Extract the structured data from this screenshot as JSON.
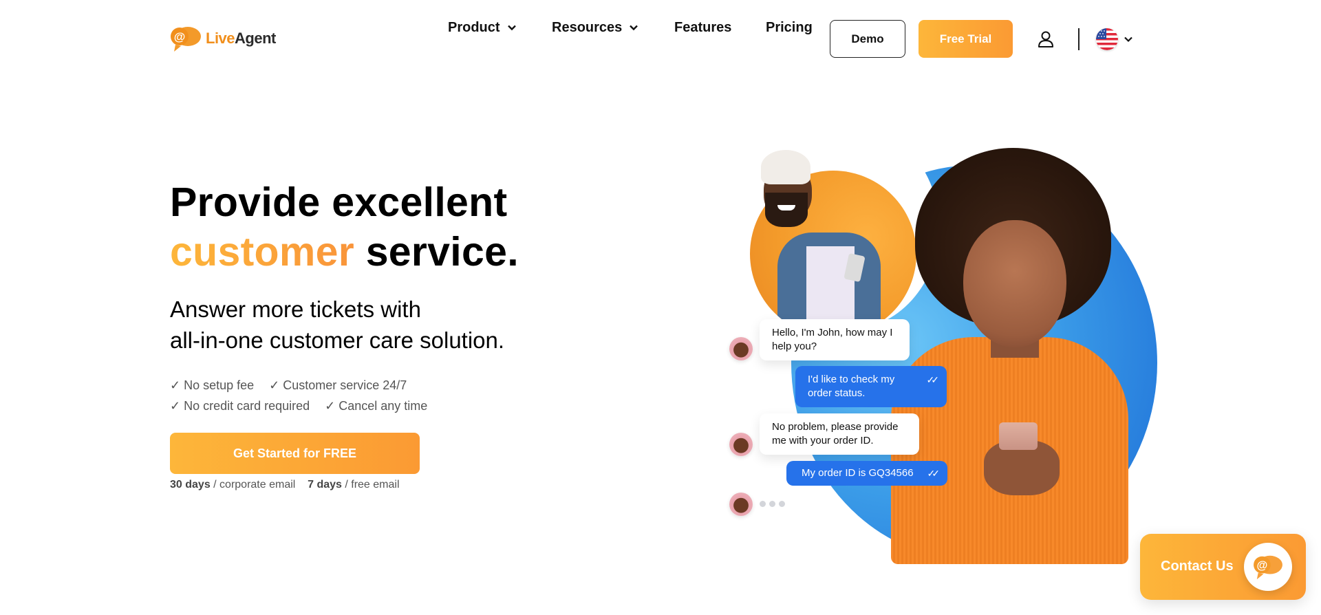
{
  "header": {
    "logo": {
      "live": "Live",
      "agent": "Agent",
      "icon": "chat-bubble-at-icon"
    },
    "nav": [
      {
        "label": "Product",
        "has_dropdown": true
      },
      {
        "label": "Resources",
        "has_dropdown": true
      },
      {
        "label": "Features",
        "has_dropdown": false
      },
      {
        "label": "Pricing",
        "has_dropdown": false
      }
    ],
    "demo_label": "Demo",
    "trial_label": "Free Trial",
    "user_icon": "user-icon",
    "language": {
      "icon": "us-flag-icon",
      "selected": "English (US)"
    }
  },
  "hero": {
    "title_line1": "Provide excellent",
    "title_accent": "customer",
    "title_rest": " service.",
    "subtitle_line1": "Answer more tickets with",
    "subtitle_line2": "all-in-one customer care solution.",
    "perks": [
      [
        "✓ No setup fee",
        "✓ Customer service 24/7"
      ],
      [
        "✓ No credit card required",
        "✓ Cancel any time"
      ]
    ],
    "cta_label": "Get Started for FREE",
    "trial_note": {
      "corporate_days": "30 days",
      "corporate_text": " / corporate email",
      "free_days": "7 days",
      "free_text": " / free email"
    }
  },
  "chat": {
    "messages": [
      {
        "from": "agent",
        "text": "Hello, I'm John, how may I help you?"
      },
      {
        "from": "customer",
        "text": "I'd like to check my order status.",
        "status": "read"
      },
      {
        "from": "agent",
        "text": "No problem, please provide me with your order ID."
      },
      {
        "from": "customer",
        "text": "My order ID is GQ34566",
        "status": "read"
      },
      {
        "from": "agent",
        "text": "",
        "typing": true
      }
    ],
    "read_ticks": "✓✓"
  },
  "contact": {
    "label": "Contact Us",
    "icon": "chat-bubble-at-icon"
  },
  "colors": {
    "accent_orange": "#fb9a33",
    "accent_orange_light": "#fdb63a",
    "chat_blue": "#2672ea",
    "logo_orange": "#f18f1c"
  }
}
